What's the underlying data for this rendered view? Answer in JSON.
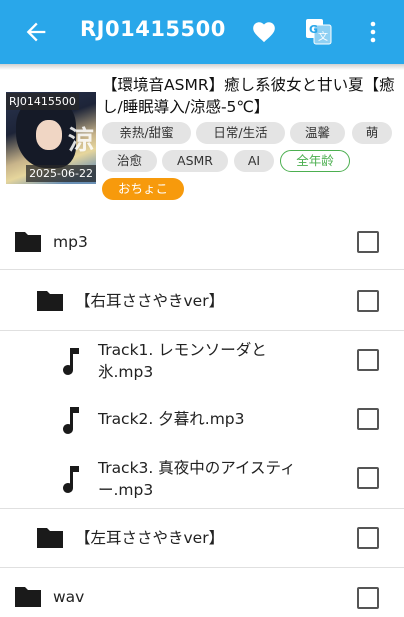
{
  "header": {
    "title": "RJ01415500",
    "icons": [
      "back-arrow-icon",
      "heart-icon",
      "translate-icon",
      "more-vert-icon"
    ]
  },
  "work": {
    "code_badge": "RJ01415500",
    "date_badge": "2025-06-22",
    "cover_text": "涼",
    "title": "【環境音ASMR】癒し系彼女と甘い夏【癒し/睡眠導入/涼感-5℃】",
    "tags": [
      "亲热/甜蜜",
      "日常/生活",
      "温馨",
      "萌",
      "治愈",
      "ASMR",
      "AI"
    ],
    "rating_tag": "全年龄",
    "circle_tag": "おちょこ"
  },
  "files": [
    {
      "type": "folder",
      "name": "mp3",
      "level": 0
    },
    {
      "type": "folder",
      "name": "【右耳ささやきver】",
      "level": 1
    },
    {
      "type": "file",
      "name": "Track1. レモンソーダと氷.mp3",
      "level": 2
    },
    {
      "type": "file",
      "name": "Track2. 夕暮れ.mp3",
      "level": 2
    },
    {
      "type": "file",
      "name": "Track3. 真夜中のアイスティー.mp3",
      "level": 2
    },
    {
      "type": "folder",
      "name": "【左耳ささやきver】",
      "level": 1
    },
    {
      "type": "folder",
      "name": "wav",
      "level": 0
    }
  ],
  "colors": {
    "appbar": "#29a7ea",
    "tag_bg": "#e4e4e4",
    "rating_green": "#4caf50",
    "circle_orange": "#f79a0c"
  }
}
